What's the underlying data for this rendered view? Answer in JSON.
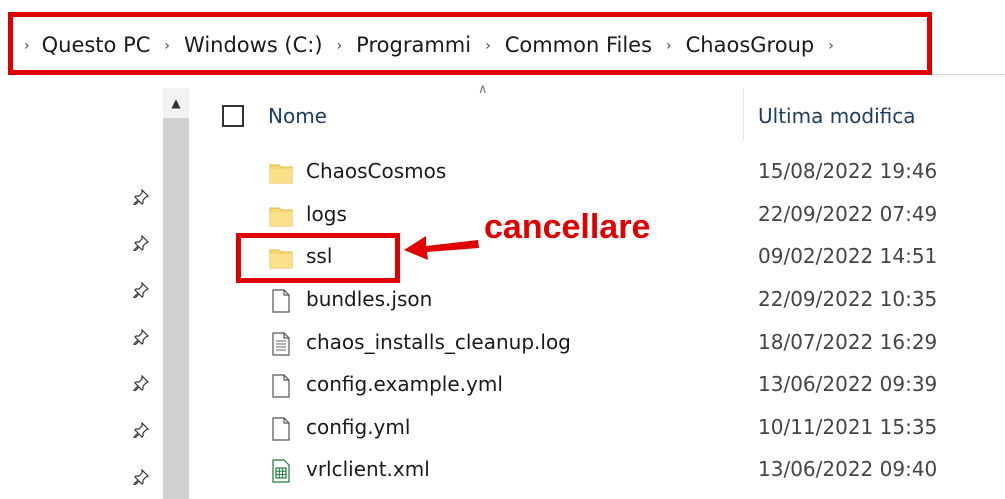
{
  "breadcrumb": {
    "items": [
      {
        "label": "Questo PC"
      },
      {
        "label": "Windows (C:)"
      },
      {
        "label": "Programmi"
      },
      {
        "label": "Common Files"
      },
      {
        "label": "ChaosGroup"
      }
    ]
  },
  "columns": {
    "name": "Nome",
    "date": "Ultima modifica"
  },
  "files": [
    {
      "name": "ChaosCosmos",
      "date": "15/08/2022 19:46",
      "type": "folder-icon"
    },
    {
      "name": "logs",
      "date": "22/09/2022 07:49",
      "type": "folder-icon"
    },
    {
      "name": "ssl",
      "date": "09/02/2022 14:51",
      "type": "folder-icon"
    },
    {
      "name": "bundles.json",
      "date": "22/09/2022 10:35",
      "type": "file-icon"
    },
    {
      "name": "chaos_installs_cleanup.log",
      "date": "18/07/2022 16:29",
      "type": "text-file-icon"
    },
    {
      "name": "config.example.yml",
      "date": "13/06/2022 09:39",
      "type": "file-icon"
    },
    {
      "name": "config.yml",
      "date": "10/11/2021 15:35",
      "type": "file-icon"
    },
    {
      "name": "vrlclient.xml",
      "date": "13/06/2022 09:40",
      "type": "spreadsheet-icon"
    }
  ],
  "annotation": {
    "text": "cancellare",
    "color": "#e00000"
  },
  "colors": {
    "highlight_red": "#e00000",
    "folder_yellow": "#f8d775",
    "header_blue": "#1f3d63"
  }
}
